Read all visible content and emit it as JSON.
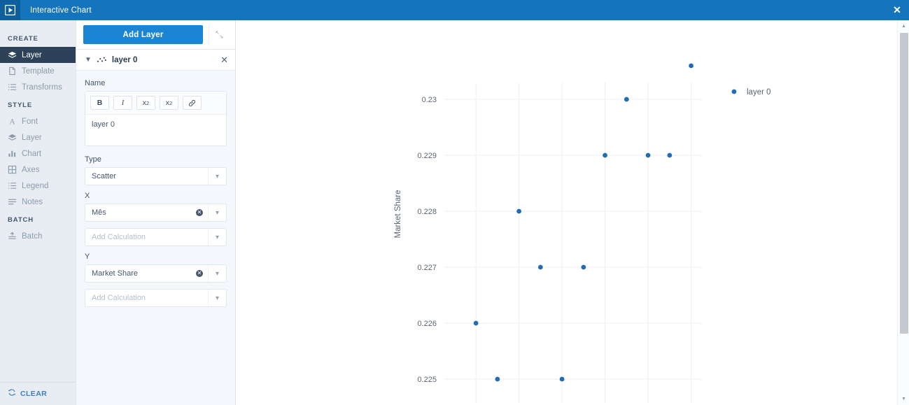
{
  "window": {
    "title": "Interactive Chart",
    "logo_icon": "play-logo-icon",
    "close_label": "✕"
  },
  "sidebar": {
    "sections": [
      {
        "label": "CREATE",
        "items": [
          {
            "label": "Layer",
            "icon": "layers-icon",
            "active": true
          },
          {
            "label": "Template",
            "icon": "document-icon",
            "active": false
          },
          {
            "label": "Transforms",
            "icon": "list-icon",
            "active": false
          }
        ]
      },
      {
        "label": "STYLE",
        "items": [
          {
            "label": "Font",
            "icon": "font-a-icon",
            "active": false
          },
          {
            "label": "Layer",
            "icon": "layers-icon",
            "active": false
          },
          {
            "label": "Chart",
            "icon": "bar-chart-icon",
            "active": false
          },
          {
            "label": "Axes",
            "icon": "grid-icon",
            "active": false
          },
          {
            "label": "Legend",
            "icon": "list-icon",
            "active": false
          },
          {
            "label": "Notes",
            "icon": "lines-icon",
            "active": false
          }
        ]
      },
      {
        "label": "BATCH",
        "items": [
          {
            "label": "Batch",
            "icon": "batch-icon",
            "active": false
          }
        ]
      }
    ],
    "footer": {
      "label": "CLEAR",
      "icon": "refresh-icon"
    }
  },
  "panel": {
    "add_layer_label": "Add Layer",
    "expand_icon": "collapse-arrows-icon",
    "layer_header": {
      "caret_icon": "chevron-down-icon",
      "type_icon": "scatter-icon",
      "title": "layer 0",
      "close_label": "✕"
    },
    "name_field": {
      "label": "Name",
      "value": "layer 0",
      "toolbar": [
        {
          "label": "B",
          "name": "bold-button"
        },
        {
          "label": "I",
          "name": "italic-button"
        },
        {
          "label": "x2",
          "name": "subscript-button"
        },
        {
          "label": "x2",
          "name": "superscript-button"
        },
        {
          "label": "ὑ7",
          "name": "link-button"
        }
      ]
    },
    "type_field": {
      "label": "Type",
      "value": "Scatter"
    },
    "x_field": {
      "label": "X",
      "value": "Mês",
      "calculation_placeholder": "Add Calculation"
    },
    "y_field": {
      "label": "Y",
      "value": "Market Share",
      "calculation_placeholder": "Add Calculation"
    }
  },
  "chart_data": {
    "type": "scatter",
    "title": "",
    "xlabel": "",
    "ylabel": "Market Share",
    "ytick_labels": [
      "0.23",
      "0.229",
      "0.228",
      "0.227",
      "0.226",
      "0.225"
    ],
    "ytick_values": [
      0.23,
      0.229,
      0.228,
      0.227,
      0.226,
      0.225
    ],
    "ylim": [
      0.2246,
      0.2303
    ],
    "xlim": [
      0.5,
      12.5
    ],
    "xtick_values": [
      2,
      4,
      6,
      8,
      10,
      12
    ],
    "xtick_labels": [],
    "grid": true,
    "legend": {
      "position": "right",
      "entries": [
        "layer 0"
      ]
    },
    "marker_color": "#1f6eb5",
    "marker_size": 5,
    "series": [
      {
        "name": "layer 0",
        "x": [
          2,
          3,
          4,
          5,
          6,
          7,
          8,
          9,
          10,
          11,
          12
        ],
        "y": [
          0.226,
          0.225,
          0.228,
          0.227,
          0.225,
          0.227,
          0.229,
          0.23,
          0.229,
          0.229,
          0.2306
        ],
        "points": [
          {
            "x": 2,
            "y": 0.226
          },
          {
            "x": 3,
            "y": 0.225
          },
          {
            "x": 4,
            "y": 0.228
          },
          {
            "x": 5,
            "y": 0.227
          },
          {
            "x": 6,
            "y": 0.225
          },
          {
            "x": 7,
            "y": 0.227
          },
          {
            "x": 8,
            "y": 0.229
          },
          {
            "x": 9,
            "y": 0.23
          },
          {
            "x": 10,
            "y": 0.229
          },
          {
            "x": 11,
            "y": 0.229
          },
          {
            "x": 12,
            "y": 0.2306
          }
        ]
      }
    ]
  },
  "scrollbar": {
    "up_arrow": "▲",
    "down_arrow": "▼"
  },
  "colors": {
    "titlebar": "#1475bc",
    "accent": "#1b85d3",
    "nav_bg": "#e8edf3",
    "nav_active": "#2d4159",
    "marker": "#1f6eb5"
  }
}
